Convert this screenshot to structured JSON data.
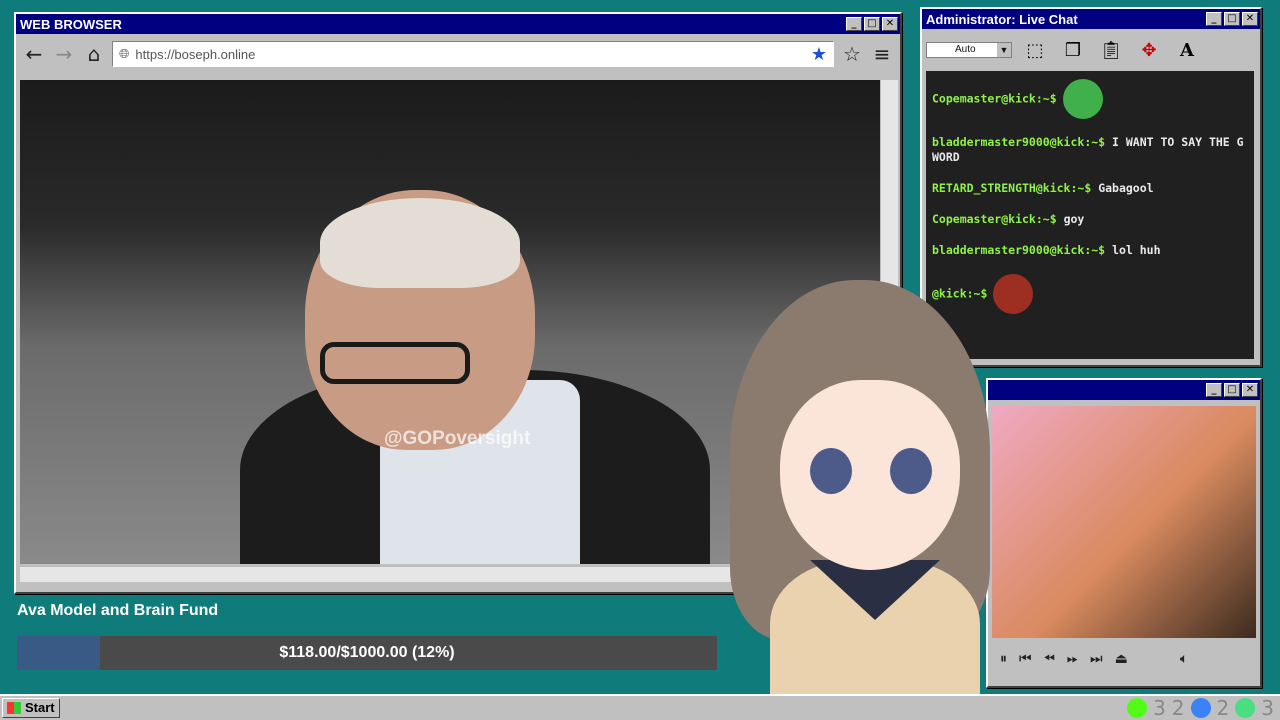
{
  "browser": {
    "title": "WEB BROWSER",
    "url": "https://boseph.online",
    "watermark": "@GOPoversight",
    "controls": {
      "minimize": "_",
      "maximize": "□",
      "close": "✕"
    }
  },
  "chat": {
    "title": "Administrator: Live Chat",
    "font_select": "Auto",
    "messages": [
      {
        "user": "Copemaster@kick:~$",
        "text": "",
        "emote": "crying-frog"
      },
      {
        "user": "bladdermaster9000@kick:~$",
        "text": "I WANT TO SAY THE G WORD"
      },
      {
        "user": "RETARD_STRENGTH@kick:~$",
        "text": "Gabagool"
      },
      {
        "user": "Copemaster@kick:~$",
        "text": "goy"
      },
      {
        "user": "bladdermaster9000@kick:~$",
        "text": "lol huh"
      },
      {
        "user": "@kick:~$",
        "text": "",
        "emote": "screaming-pepe"
      }
    ]
  },
  "fund": {
    "title": "Ava Model and Brain Fund",
    "progress_text": "$118.00/$1000.00 (12%)",
    "progress_fraction": 0.118
  },
  "taskbar": {
    "start_label": "Start",
    "tray_counts": [
      "3",
      "2",
      "2",
      "3"
    ]
  },
  "colors": {
    "desktop": "#0f7b7b",
    "titlebar": "#000080",
    "chat_user": "#8ef24a",
    "fund_fill": "#3a5a86"
  }
}
